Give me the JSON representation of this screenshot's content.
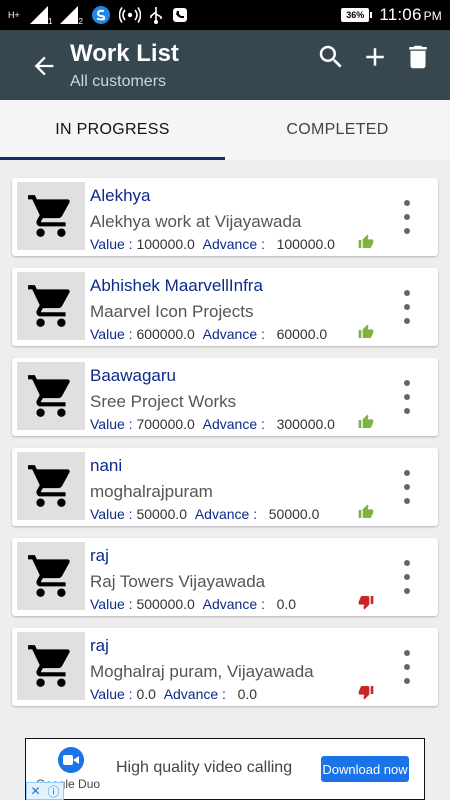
{
  "status_bar": {
    "network_1": "H+",
    "network_2": "H+",
    "sim_1": "1",
    "sim_2": "2",
    "battery": "36%",
    "time": "11:06",
    "ampm": "PM"
  },
  "app_bar": {
    "title": "Work List",
    "subtitle": "All customers"
  },
  "tabs": [
    {
      "label": "IN PROGRESS",
      "active": true
    },
    {
      "label": "COMPLETED",
      "active": false
    }
  ],
  "value_label": "Value :",
  "advance_label": "Advance :",
  "items": [
    {
      "name": "Alekhya",
      "description": "Alekhya work at Vijayawada",
      "value": "100000.0",
      "advance": "100000.0",
      "status": "thumbs-up"
    },
    {
      "name": "Abhishek MaarvellInfra",
      "description": "Maarvel Icon Projects",
      "value": "600000.0",
      "advance": "60000.0",
      "status": "thumbs-up"
    },
    {
      "name": "Baawagaru",
      "description": "Sree Project Works",
      "value": "700000.0",
      "advance": "300000.0",
      "status": "thumbs-up"
    },
    {
      "name": "nani",
      "description": "moghalrajpuram",
      "value": "50000.0",
      "advance": "50000.0",
      "status": "thumbs-up"
    },
    {
      "name": "raj",
      "description": "Raj Towers Vijayawada",
      "value": "500000.0",
      "advance": "0.0",
      "status": "thumbs-down"
    },
    {
      "name": "raj",
      "description": "Moghalraj puram, Vijayawada",
      "value": "0.0",
      "advance": "0.0",
      "status": "thumbs-down"
    }
  ],
  "ad": {
    "brand": "Google Duo",
    "text": "High quality video calling",
    "button": "Download now"
  },
  "colors": {
    "app_bar": "#37474f",
    "tab_indicator": "#1a2a6c",
    "name_text": "#0d2a8a",
    "thumbs_up": "#7cb342",
    "thumbs_down": "#c62828"
  }
}
